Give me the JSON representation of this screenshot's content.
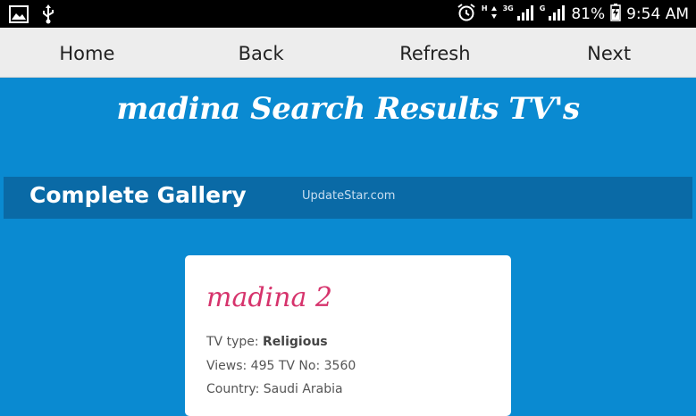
{
  "status_bar": {
    "net1": "H",
    "net2": "3G",
    "net3": "G",
    "battery": "81%",
    "time": "9:54 AM",
    "icons": [
      "image-icon",
      "usb-icon",
      "alarm-icon",
      "signal-icon",
      "signal-icon",
      "battery-icon"
    ]
  },
  "nav": {
    "home": "Home",
    "back": "Back",
    "refresh": "Refresh",
    "next": "Next"
  },
  "page": {
    "title": "madina Search Results TV's"
  },
  "gallery": {
    "title": "Complete Gallery",
    "watermark": "UpdateStar.com"
  },
  "card": {
    "title": "madina 2",
    "type_label": "TV type: ",
    "type_value": "Religious",
    "views_line": "Views: 495 TV No: 3560",
    "country_line": "Country: Saudi Arabia"
  },
  "colors": {
    "background": "#0a8ad1",
    "gallery_bar": "#0a6aa6",
    "card_title": "#d6336c"
  }
}
